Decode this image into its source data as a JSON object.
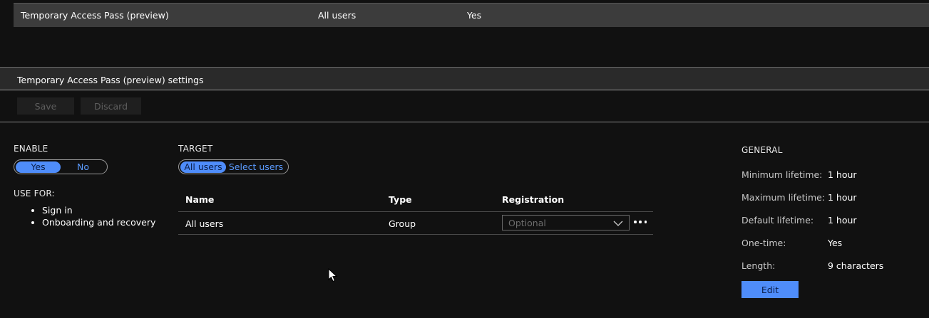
{
  "summary": {
    "method": "Temporary Access Pass (preview)",
    "target": "All users",
    "enabled": "Yes"
  },
  "settings": {
    "title": "Temporary Access Pass (preview) settings",
    "save_label": "Save",
    "discard_label": "Discard"
  },
  "enable": {
    "label": "ENABLE",
    "yes": "Yes",
    "no": "No",
    "selected": "Yes"
  },
  "use_for": {
    "label": "USE FOR:",
    "items": [
      "Sign in",
      "Onboarding and recovery"
    ]
  },
  "target": {
    "label": "TARGET",
    "all_users": "All users",
    "select_users": "Select users",
    "selected": "All users"
  },
  "table": {
    "headers": {
      "name": "Name",
      "type": "Type",
      "registration": "Registration"
    },
    "rows": [
      {
        "name": "All users",
        "type": "Group",
        "registration": "Optional"
      }
    ]
  },
  "general": {
    "label": "GENERAL",
    "fields": [
      {
        "label": "Minimum lifetime:",
        "value": "1 hour"
      },
      {
        "label": "Maximum lifetime:",
        "value": "1 hour"
      },
      {
        "label": "Default lifetime:",
        "value": "1 hour"
      },
      {
        "label": "One-time:",
        "value": "Yes"
      },
      {
        "label": "Length:",
        "value": "9 characters"
      }
    ],
    "edit_label": "Edit"
  },
  "colors": {
    "accent": "#4f8dfa",
    "link": "#5b9bff",
    "background": "#111111"
  },
  "icons": {
    "dropdown": "chevron-down-icon",
    "more": "more-horizontal-icon",
    "cursor": "mouse-pointer-icon"
  }
}
